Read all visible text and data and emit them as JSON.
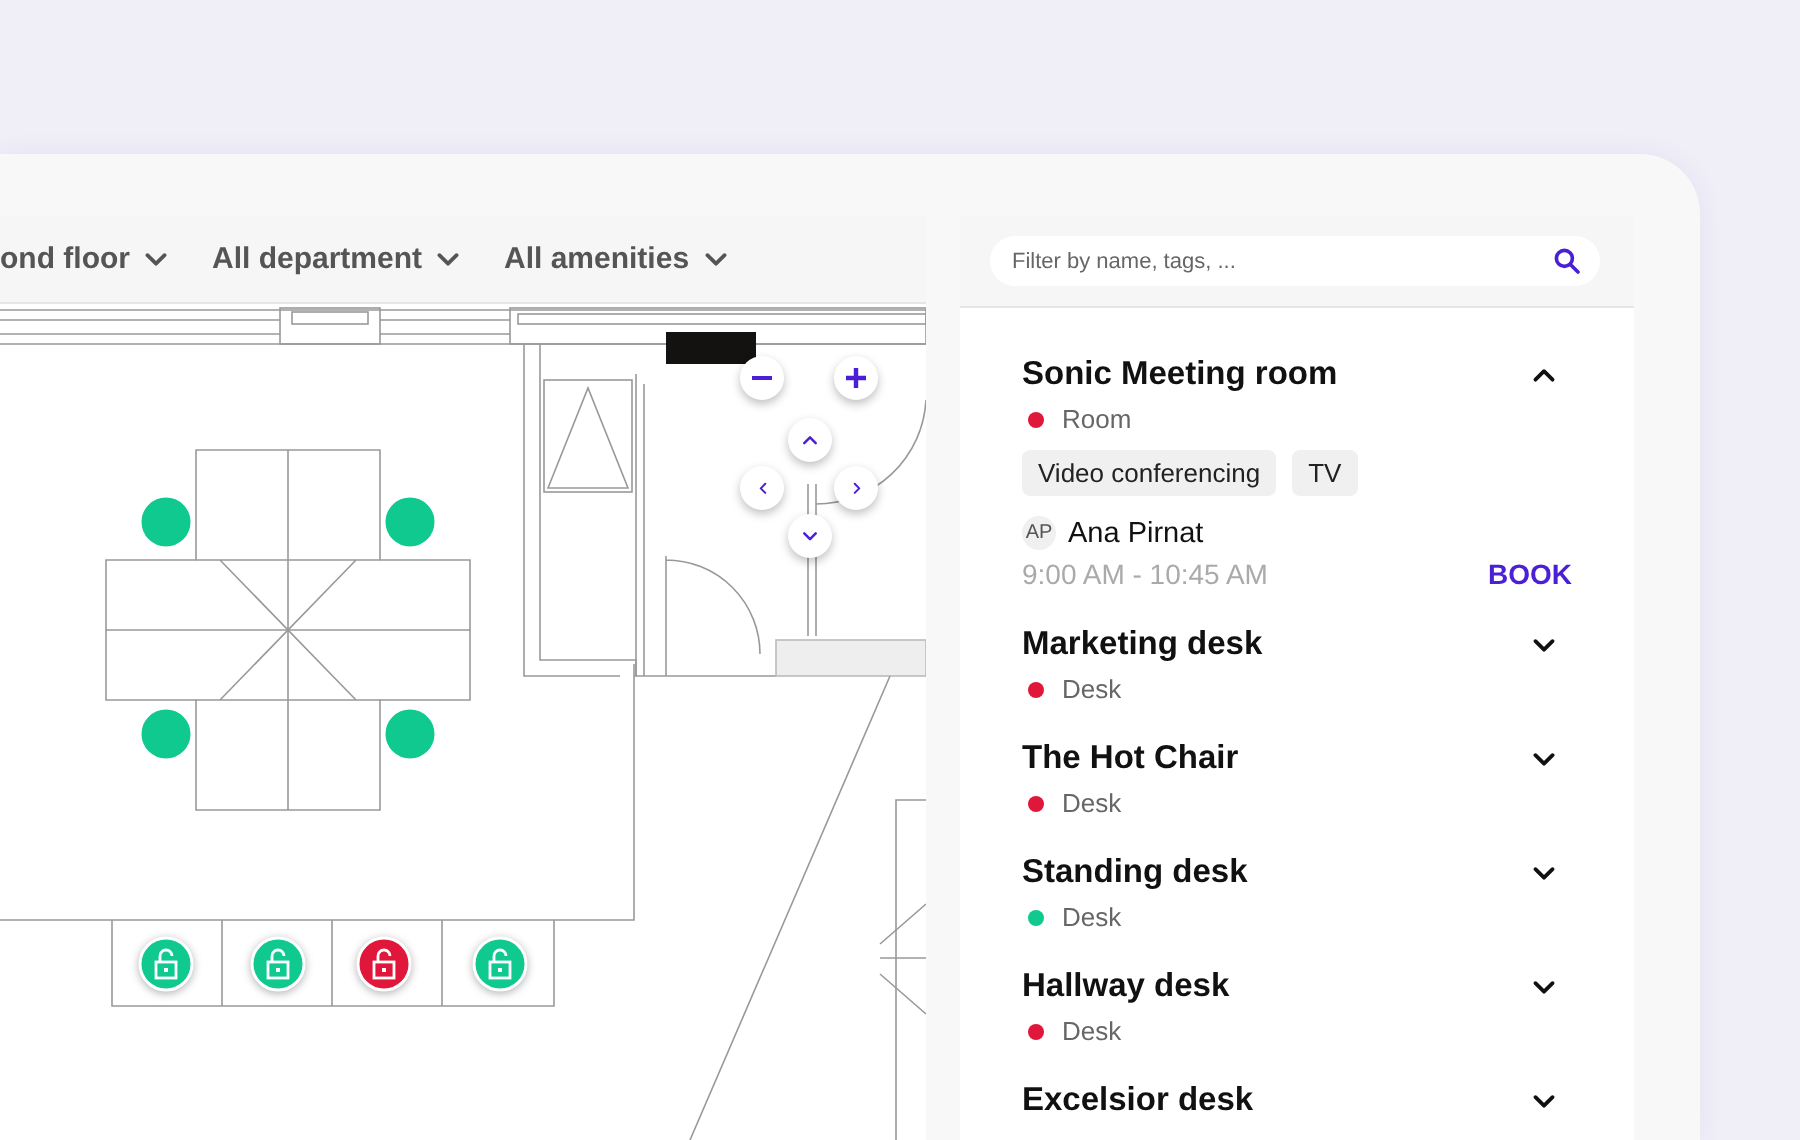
{
  "filters": [
    {
      "label": "ond floor"
    },
    {
      "label": "All department"
    },
    {
      "label": "All amenities"
    }
  ],
  "map": {
    "seats": [
      {
        "color": "#10c98f"
      },
      {
        "color": "#10c98f"
      },
      {
        "color": "#10c98f"
      },
      {
        "color": "#10c98f"
      }
    ],
    "lockers": [
      {
        "color": "#10c98f"
      },
      {
        "color": "#10c98f"
      },
      {
        "color": "#e0173a"
      },
      {
        "color": "#10c98f"
      }
    ]
  },
  "search": {
    "placeholder": "Filter by name, tags, ..."
  },
  "spaces": [
    {
      "name": "Sonic Meeting room",
      "type": "Room",
      "color": "#e0173a",
      "expanded": true,
      "tags": [
        "Video conferencing",
        "TV"
      ],
      "booking": {
        "initials": "AP",
        "person": "Ana Pirnat",
        "time": "9:00 AM - 10:45 AM",
        "action": "BOOK"
      }
    },
    {
      "name": "Marketing desk",
      "type": "Desk",
      "color": "#e0173a",
      "expanded": false
    },
    {
      "name": "The Hot Chair",
      "type": "Desk",
      "color": "#e0173a",
      "expanded": false
    },
    {
      "name": "Standing desk",
      "type": "Desk",
      "color": "#10c98f",
      "expanded": false
    },
    {
      "name": "Hallway desk",
      "type": "Desk",
      "color": "#e0173a",
      "expanded": false
    },
    {
      "name": "Excelsior desk",
      "expanded": false
    }
  ]
}
